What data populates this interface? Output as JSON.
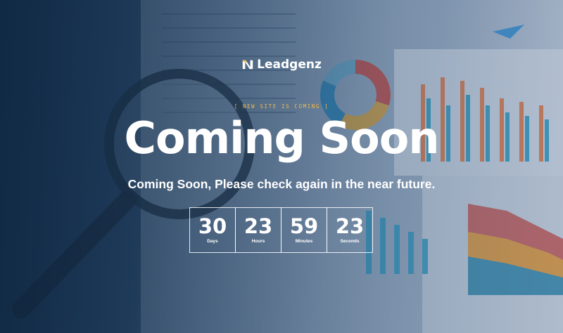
{
  "brand": {
    "name": "Leadgenz"
  },
  "tagline": "[ NEW SITE IS COMING ]",
  "headline": "Coming Soon",
  "subline": "Coming Soon, Please check again in the near future.",
  "countdown": [
    {
      "value": "30",
      "label": "Days"
    },
    {
      "value": "23",
      "label": "Hours"
    },
    {
      "value": "59",
      "label": "Minutes"
    },
    {
      "value": "23",
      "label": "Seconds"
    }
  ],
  "colors": {
    "accent": "#f2b94a",
    "text": "#ffffff",
    "background": "#23405e"
  },
  "icons": {
    "logo": "leadgenz-logo-icon",
    "magnifier": "magnifying-glass-icon"
  }
}
